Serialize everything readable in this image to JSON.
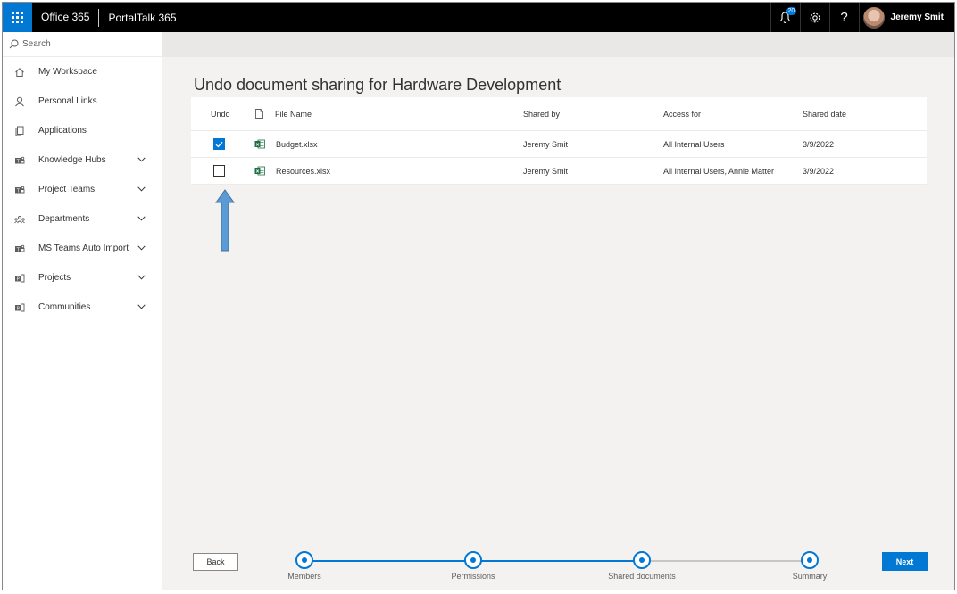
{
  "topbar": {
    "brand": "Office 365",
    "app_name": "PortalTalk 365",
    "notification_count": "20",
    "help_label": "?",
    "user_name": "Jeremy Smit"
  },
  "sidebar": {
    "search_placeholder": "Search",
    "items": [
      {
        "label": "My Workspace",
        "icon": "home-icon",
        "expandable": false
      },
      {
        "label": "Personal Links",
        "icon": "person-icon",
        "expandable": false
      },
      {
        "label": "Applications",
        "icon": "copy-icon",
        "expandable": false
      },
      {
        "label": "Knowledge Hubs",
        "icon": "teams-icon",
        "expandable": true
      },
      {
        "label": "Project Teams",
        "icon": "teams-icon",
        "expandable": true
      },
      {
        "label": "Departments",
        "icon": "org-icon",
        "expandable": true
      },
      {
        "label": "MS Teams Auto Import",
        "icon": "teams-icon",
        "expandable": true
      },
      {
        "label": "Projects",
        "icon": "project-icon",
        "expandable": true
      },
      {
        "label": "Communities",
        "icon": "project-icon",
        "expandable": true
      }
    ]
  },
  "main": {
    "title": "Undo document sharing for Hardware Development",
    "table": {
      "headers": {
        "undo": "Undo",
        "file_name": "File Name",
        "shared_by": "Shared by",
        "access_for": "Access for",
        "shared_date": "Shared date"
      },
      "rows": [
        {
          "checked": true,
          "file_name": "Budget.xlsx",
          "shared_by": "Jeremy Smit",
          "access_for": "All Internal Users",
          "shared_date": "3/9/2022"
        },
        {
          "checked": false,
          "file_name": "Resources.xlsx",
          "shared_by": "Jeremy Smit",
          "access_for": "All Internal Users, Annie Matter",
          "shared_date": "3/9/2022"
        }
      ]
    }
  },
  "wizard": {
    "back_label": "Back",
    "next_label": "Next",
    "steps": [
      {
        "label": "Members",
        "completed": true
      },
      {
        "label": "Permissions",
        "completed": true
      },
      {
        "label": "Shared documents",
        "completed": false
      },
      {
        "label": "Summary",
        "completed": false
      }
    ]
  },
  "colors": {
    "accent": "#0078d4",
    "topbar": "#000000",
    "background": "#f3f2f1",
    "annotation_arrow": "#5b9bd5"
  }
}
